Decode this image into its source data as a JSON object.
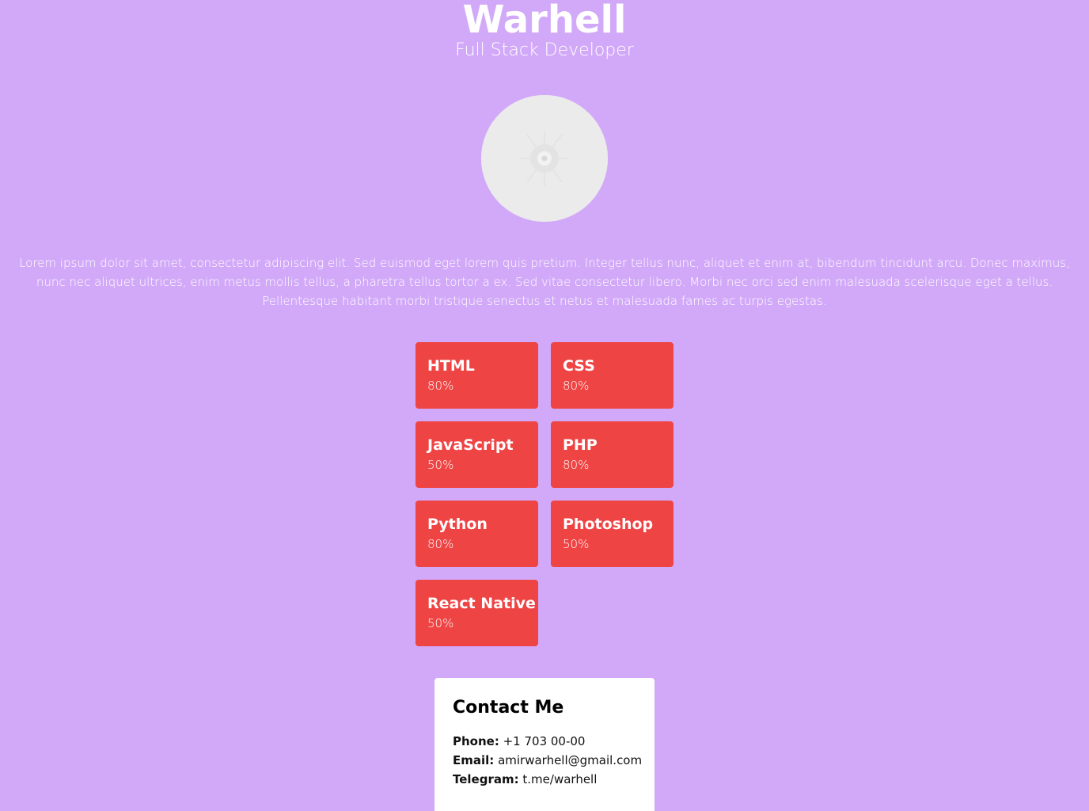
{
  "profile": {
    "name": "Warhell",
    "role": "Full Stack Developer",
    "bio": "Lorem ipsum dolor sit amet, consectetur adipiscing elit. Sed euismod eget lorem quis pretium. Integer tellus nunc, aliquet et enim at, bibendum tincidunt arcu. Donec maximus, nunc nec aliquet ultrices, enim metus mollis tellus, a pharetra tellus tortor a ex. Sed vitae consectetur libero. Morbi nec orci sed enim malesuada scelerisque eget a tellus. Pellentesque habitant morbi tristique senectus et netus et malesuada fames ac turpis egestas."
  },
  "skills": [
    {
      "name": "HTML",
      "level": "80%"
    },
    {
      "name": "CSS",
      "level": "80%"
    },
    {
      "name": "JavaScript",
      "level": "50%"
    },
    {
      "name": "PHP",
      "level": "80%"
    },
    {
      "name": "Python",
      "level": "80%"
    },
    {
      "name": "Photoshop",
      "level": "50%"
    },
    {
      "name": "React Native",
      "level": "50%"
    }
  ],
  "contact": {
    "title": "Contact Me",
    "phone_label": "Phone:",
    "phone": "+1 703 00-00",
    "email_label": "Email:",
    "email": "amirwarhell@gmail.com",
    "telegram_label": "Telegram:",
    "telegram": "t.me/warhell"
  },
  "colors": {
    "background": "#d2a9f8",
    "skill_card": "#ef4444",
    "contact_card": "#ffffff"
  },
  "icons": {
    "avatar": "image-placeholder-icon"
  }
}
